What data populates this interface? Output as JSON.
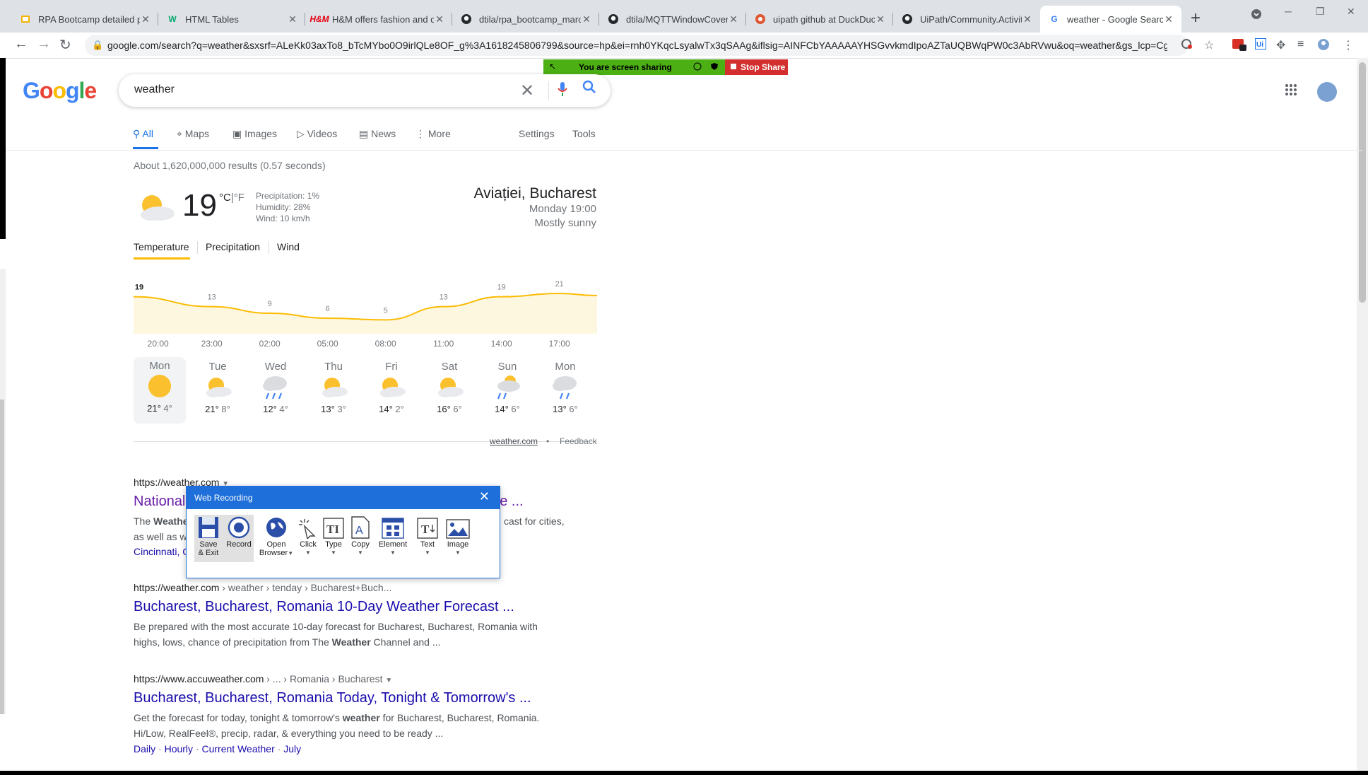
{
  "browser": {
    "tabs": [
      {
        "title": "RPA Bootcamp detailed pr",
        "icon": "slides-icon"
      },
      {
        "title": "HTML Tables",
        "icon": "w3schools-icon"
      },
      {
        "title": "H&M offers fashion and q",
        "icon": "hm-icon"
      },
      {
        "title": "dtila/rpa_bootcamp_march",
        "icon": "github-icon"
      },
      {
        "title": "dtila/MQTTWindowCover",
        "icon": "github-icon"
      },
      {
        "title": "uipath github at DuckDuck",
        "icon": "duckduckgo-icon"
      },
      {
        "title": "UiPath/Community.Activitie",
        "icon": "github-icon"
      },
      {
        "title": "weather - Google Search",
        "icon": "google-icon"
      }
    ],
    "new_tab": "+",
    "url": "google.com/search?q=weather&sxsrf=ALeKk03axTo8_bTcMYbo0O9irlQLe8OF_g%3A1618245806799&source=hp&ei=rnh0YKqcLsyalwTx3qSAAg&iflsig=AINFCbYAAAAAYHSGvvkmdIpoAZTaUQBWqPW0c3AbRVwu&oq=weather&gs_lcp=Cgdn..."
  },
  "share": {
    "label": "You are screen sharing",
    "stop_label": "Stop Share"
  },
  "google": {
    "logo": [
      "G",
      "o",
      "o",
      "g",
      "l",
      "e"
    ],
    "logo_colors": [
      "#4285f4",
      "#ea4335",
      "#fbbc05",
      "#4285f4",
      "#34a853",
      "#ea4335"
    ],
    "query": "weather",
    "nav": [
      {
        "label": "All",
        "icon": "search-icon"
      },
      {
        "label": "Maps",
        "icon": "map-pin-icon"
      },
      {
        "label": "Images",
        "icon": "image-icon"
      },
      {
        "label": "Videos",
        "icon": "play-icon"
      },
      {
        "label": "News",
        "icon": "news-icon"
      },
      {
        "label": "More",
        "icon": "more-vert-icon"
      }
    ],
    "settings": "Settings",
    "tools": "Tools",
    "stats": "About 1,620,000,000 results (0.57 seconds)"
  },
  "weather": {
    "temp": "19",
    "unit_c": "°C",
    "unit_sep": "|",
    "unit_f": "°F",
    "precipitation": "Precipitation: 1%",
    "humidity": "Humidity: 28%",
    "wind": "Wind: 10 km/h",
    "location": "Aviației, Bucharest",
    "time": "Monday 19:00",
    "condition": "Mostly sunny",
    "tabs": [
      "Temperature",
      "Precipitation",
      "Wind"
    ],
    "source": "weather.com",
    "dot": "•",
    "feedback": "Feedback",
    "days": [
      {
        "name": "Mon",
        "hi": "21°",
        "lo": "4°",
        "icon": "sunny-icon"
      },
      {
        "name": "Tue",
        "hi": "21°",
        "lo": "8°",
        "icon": "partly-sunny-icon"
      },
      {
        "name": "Wed",
        "hi": "12°",
        "lo": "4°",
        "icon": "rain-icon"
      },
      {
        "name": "Thu",
        "hi": "13°",
        "lo": "3°",
        "icon": "partly-sunny-icon"
      },
      {
        "name": "Fri",
        "hi": "14°",
        "lo": "2°",
        "icon": "partly-sunny-icon"
      },
      {
        "name": "Sat",
        "hi": "16°",
        "lo": "6°",
        "icon": "partly-sunny-icon"
      },
      {
        "name": "Sun",
        "hi": "14°",
        "lo": "6°",
        "icon": "showers-icon"
      },
      {
        "name": "Mon",
        "hi": "13°",
        "lo": "6°",
        "icon": "light-rain-icon"
      }
    ]
  },
  "chart_data": {
    "type": "area",
    "x": [
      "20:00",
      "23:00",
      "02:00",
      "05:00",
      "08:00",
      "11:00",
      "14:00",
      "17:00"
    ],
    "values": [
      19,
      13,
      9,
      6,
      5,
      13,
      19,
      21
    ],
    "series": [
      {
        "values": [
          19,
          13,
          9,
          6,
          5,
          13,
          19,
          21
        ]
      }
    ],
    "color": "#fbbc04",
    "fill": "#fef7e0"
  },
  "results": [
    {
      "cite": "https://weather.com",
      "path": "",
      "title": "National",
      "title_tail": "ane ...",
      "snippet_a": "The ",
      "snippet_b": "Weathe",
      "snippet_tail": "cast for cities,",
      "snippet_line2": "as well as w",
      "sitelink": "Cincinnati, C"
    },
    {
      "cite": "https://weather.com",
      "path": " › weather › tenday › Bucharest+Buch...",
      "title": "Bucharest, Bucharest, Romania 10-Day Weather Forecast ...",
      "snippet_1": "Be prepared with the most accurate 10-day forecast for Bucharest, Bucharest, Romania with",
      "snippet_2a": "highs, lows, chance of precipitation from The ",
      "snippet_2b": "Weather",
      "snippet_2c": " Channel and ..."
    },
    {
      "cite": "https://www.accuweather.com",
      "path": " › ... › Romania › Bucharest",
      "title": "Bucharest, Bucharest, Romania Today, Tonight & Tomorrow's ...",
      "snippet_1a": "Get the forecast for today, tonight & tomorrow's ",
      "snippet_1b": "weather",
      "snippet_1c": " for Bucharest, Bucharest, Romania.",
      "snippet_2": "Hi/Low, RealFeel®, precip, radar, & everything you need to be ready ...",
      "sitelinks": [
        "Daily",
        "Hourly",
        "Current Weather",
        "July"
      ],
      "sitelink_sep": "·"
    }
  ],
  "web_recording": {
    "title": "Web Recording",
    "buttons": [
      {
        "label1": "Save",
        "label2": "& Exit"
      },
      {
        "label1": "Record",
        "label2": ""
      },
      {
        "label1": "Open",
        "label2": "Browser"
      },
      {
        "label1": "Click",
        "label2": ""
      },
      {
        "label1": "Type",
        "label2": ""
      },
      {
        "label1": "Copy",
        "label2": ""
      },
      {
        "label1": "Element",
        "label2": ""
      },
      {
        "label1": "Text",
        "label2": ""
      },
      {
        "label1": "Image",
        "label2": ""
      }
    ]
  }
}
